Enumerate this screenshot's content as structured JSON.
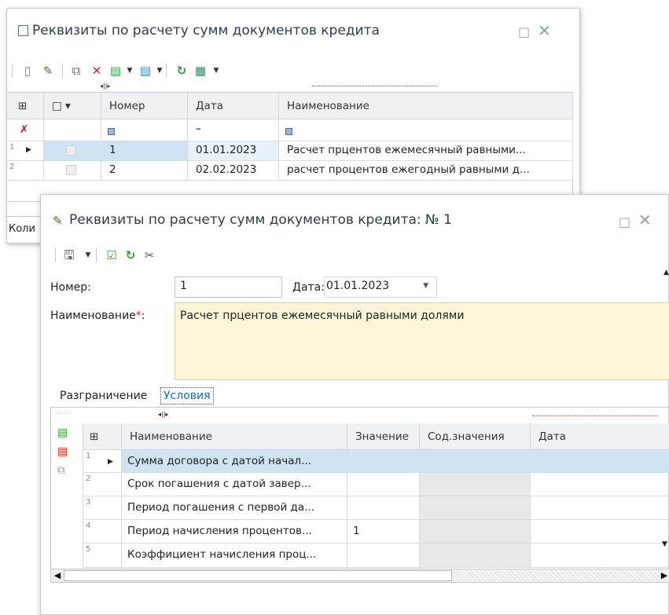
{
  "back_window": {
    "title": "Реквизиты по расчету сумм документов кредита",
    "status_prefix": "Коли",
    "table": {
      "headers": [
        "Номер",
        "Дата",
        "Наименование"
      ],
      "rows": [
        {
          "num": "1",
          "number": "1",
          "date": "01.01.2023",
          "name": "Расчет прцентов ежемесячный равными..."
        },
        {
          "num": "2",
          "number": "2",
          "date": "02.02.2023",
          "name": "расчет процентов ежегодный равными д..."
        }
      ]
    }
  },
  "front_window": {
    "title": "Реквизиты по расчету сумм документов кредита: № 1",
    "form": {
      "number_label": "Номер:",
      "number_value": "1",
      "date_label": "Дата:",
      "date_value": "01.01.2023",
      "name_label": "Наименование",
      "required_mark": "*",
      "name_colon": ":",
      "name_value": "Расчет прцентов ежемесячный равными долями"
    },
    "tabs": [
      "Разграничение",
      "Условия"
    ],
    "active_tab": "Условия",
    "conditions": {
      "headers": [
        "Наименование",
        "Значение",
        "Сод.значения",
        "Дата"
      ],
      "rows": [
        {
          "num": "1",
          "name": "Сумма договора с датой начал...",
          "value": ""
        },
        {
          "num": "2",
          "name": "Срок погашения с датой завер...",
          "value": ""
        },
        {
          "num": "3",
          "name": "Период погашения с первой да...",
          "value": ""
        },
        {
          "num": "4",
          "name": "Период начисления процентов...",
          "value": "1"
        },
        {
          "num": "5",
          "name": "Коэффициент начисления проц...",
          "value": ""
        }
      ]
    }
  },
  "colors": {
    "selection": "#cfe3f3",
    "name_field_bg": "#fbf6d8",
    "accent": "#0a73c4",
    "delete_red": "#e0241b",
    "refresh_green": "#2fa33a"
  }
}
